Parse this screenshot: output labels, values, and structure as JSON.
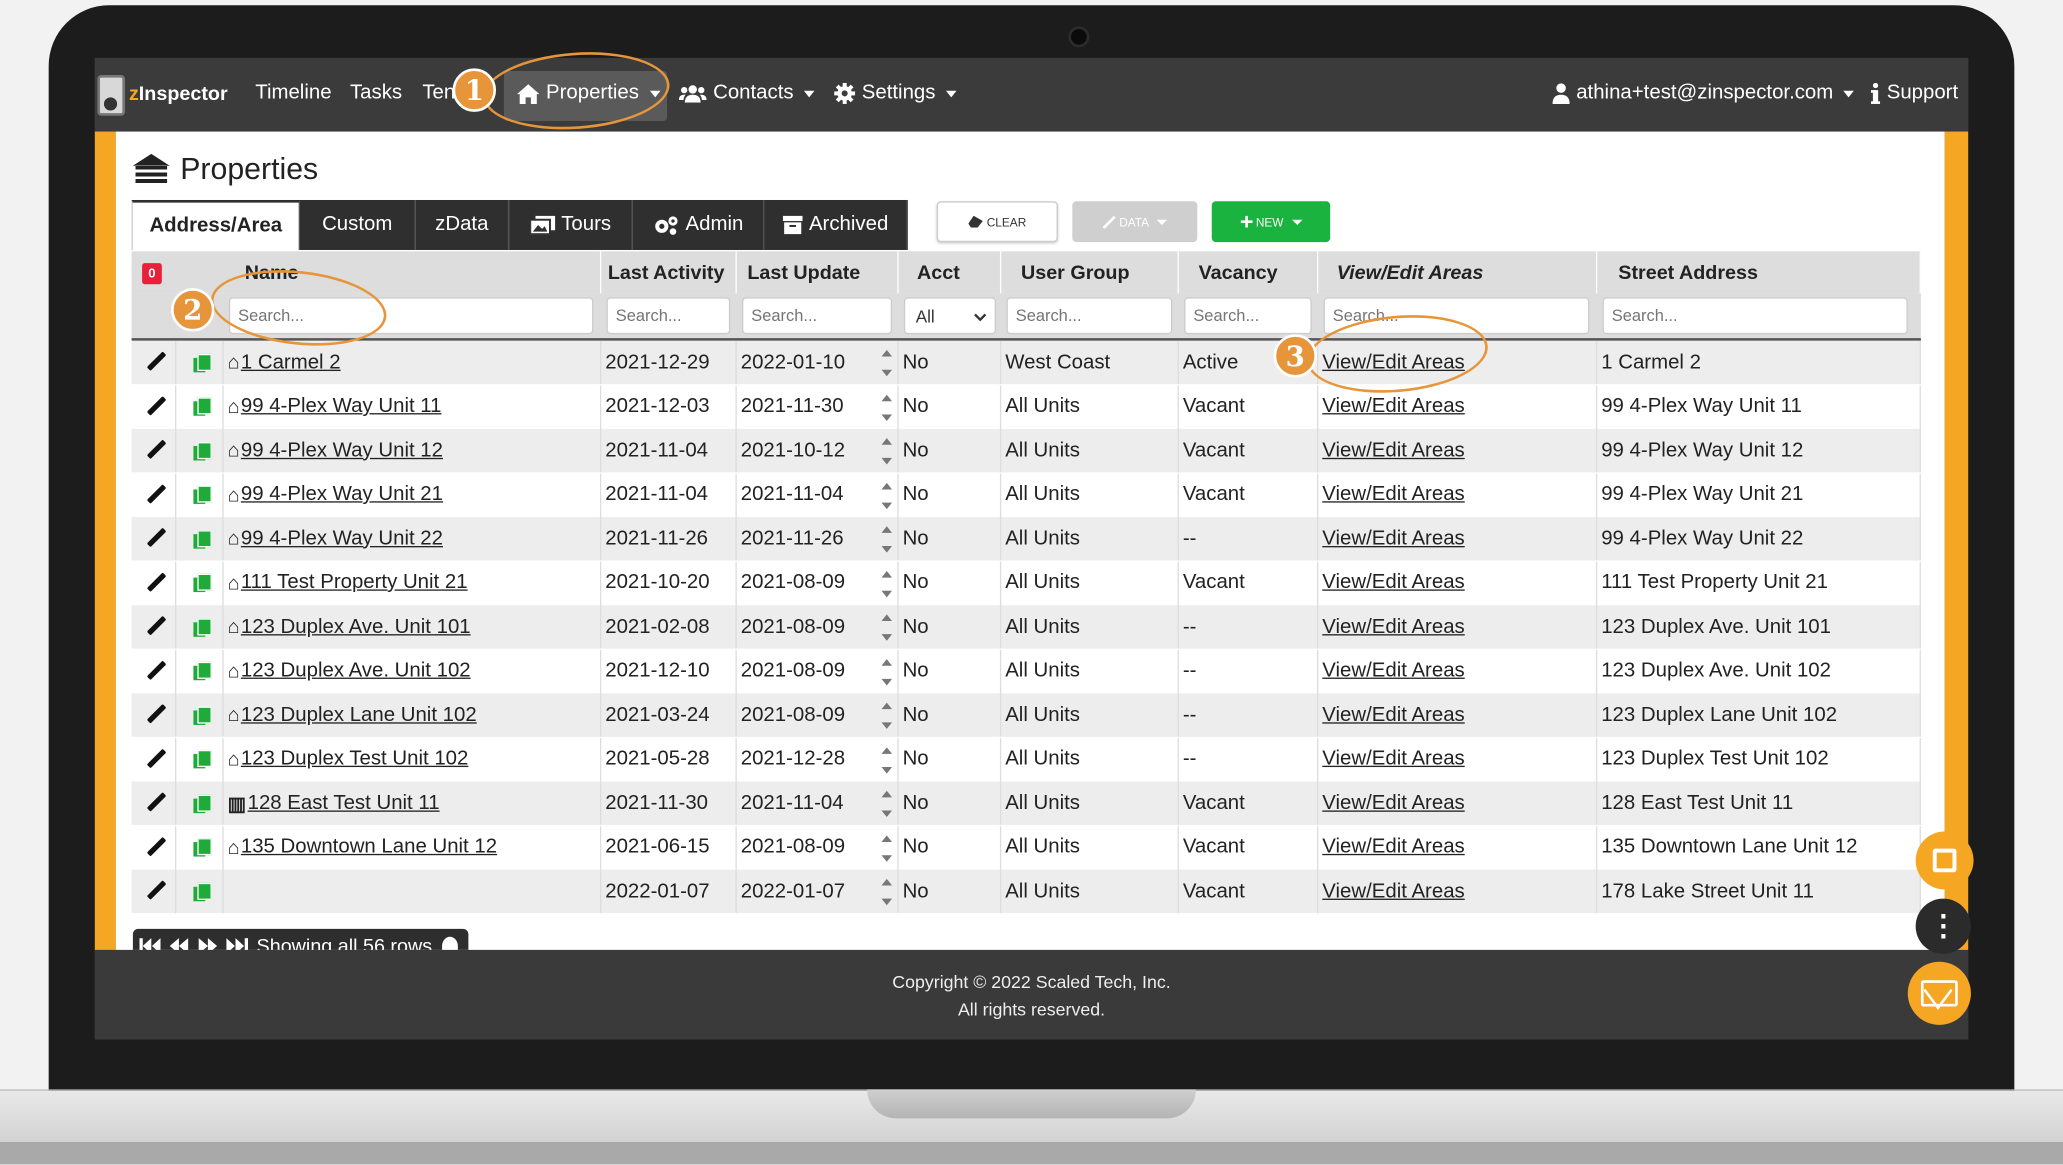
{
  "nav": {
    "brand": "zInspector",
    "brand_prefix": "z",
    "brand_suffix": "Inspector",
    "items": [
      "Timeline",
      "Tasks",
      "Templates"
    ],
    "items_visible": [
      "Timeline",
      "Tasks",
      "Ten"
    ],
    "properties": "Properties",
    "contacts": "Contacts",
    "settings": "Settings",
    "user": "athina+test@zinspector.com",
    "support": "Support"
  },
  "page": {
    "title": "Properties"
  },
  "tabs": [
    "Address/Area",
    "Custom",
    "zData",
    "Tours",
    "Admin",
    "Archived"
  ],
  "toolbar": {
    "clear": "CLEAR",
    "data": "DATA",
    "new": "NEW"
  },
  "table": {
    "badge": "0",
    "columns": [
      "Name",
      "Last Activity",
      "Last Update",
      "Acct",
      "User Group",
      "Vacancy",
      "View/Edit Areas",
      "Street Address"
    ],
    "search_placeholder": "Search...",
    "acct_filter": "All",
    "rows": [
      {
        "name": "1 Carmel 2",
        "icon": "home",
        "activity": "2021-12-29",
        "update": "2022-01-10",
        "acct": "No",
        "group": "West Coast",
        "vacancy": "Active",
        "areas": "View/Edit Areas",
        "address": "1 Carmel 2"
      },
      {
        "name": "99 4-Plex Way Unit 11",
        "icon": "home",
        "activity": "2021-12-03",
        "update": "2021-11-30",
        "acct": "No",
        "group": "All Units",
        "vacancy": "Vacant",
        "areas": "View/Edit Areas",
        "address": "99 4-Plex Way Unit 11"
      },
      {
        "name": "99 4-Plex Way Unit 12",
        "icon": "home",
        "activity": "2021-11-04",
        "update": "2021-10-12",
        "acct": "No",
        "group": "All Units",
        "vacancy": "Vacant",
        "areas": "View/Edit Areas",
        "address": "99 4-Plex Way Unit 12"
      },
      {
        "name": "99 4-Plex Way Unit 21",
        "icon": "home",
        "activity": "2021-11-04",
        "update": "2021-11-04",
        "acct": "No",
        "group": "All Units",
        "vacancy": "Vacant",
        "areas": "View/Edit Areas",
        "address": "99 4-Plex Way Unit 21"
      },
      {
        "name": "99 4-Plex Way Unit 22",
        "icon": "home",
        "activity": "2021-11-26",
        "update": "2021-11-26",
        "acct": "No",
        "group": "All Units",
        "vacancy": "--",
        "areas": "View/Edit Areas",
        "address": "99 4-Plex Way Unit 22"
      },
      {
        "name": "111 Test Property Unit 21",
        "icon": "home",
        "activity": "2021-10-20",
        "update": "2021-08-09",
        "acct": "No",
        "group": "All Units",
        "vacancy": "Vacant",
        "areas": "View/Edit Areas",
        "address": "111 Test Property Unit 21"
      },
      {
        "name": "123 Duplex Ave. Unit 101",
        "icon": "home",
        "activity": "2021-02-08",
        "update": "2021-08-09",
        "acct": "No",
        "group": "All Units",
        "vacancy": "--",
        "areas": "View/Edit Areas",
        "address": "123 Duplex Ave. Unit 101"
      },
      {
        "name": "123 Duplex Ave. Unit 102",
        "icon": "home",
        "activity": "2021-12-10",
        "update": "2021-08-09",
        "acct": "No",
        "group": "All Units",
        "vacancy": "--",
        "areas": "View/Edit Areas",
        "address": "123 Duplex Ave. Unit 102"
      },
      {
        "name": "123 Duplex Lane Unit 102",
        "icon": "home",
        "activity": "2021-03-24",
        "update": "2021-08-09",
        "acct": "No",
        "group": "All Units",
        "vacancy": "--",
        "areas": "View/Edit Areas",
        "address": "123 Duplex Lane Unit 102"
      },
      {
        "name": "123 Duplex Test Unit 102",
        "icon": "home",
        "activity": "2021-05-28",
        "update": "2021-12-28",
        "acct": "No",
        "group": "All Units",
        "vacancy": "--",
        "areas": "View/Edit Areas",
        "address": "123 Duplex Test Unit 102"
      },
      {
        "name": "128 East Test Unit 11",
        "icon": "building",
        "activity": "2021-11-30",
        "update": "2021-11-04",
        "acct": "No",
        "group": "All Units",
        "vacancy": "Vacant",
        "areas": "View/Edit Areas",
        "address": "128 East Test Unit 11"
      },
      {
        "name": "135 Downtown Lane Unit 12",
        "icon": "home",
        "activity": "2021-06-15",
        "update": "2021-08-09",
        "acct": "No",
        "group": "All Units",
        "vacancy": "Vacant",
        "areas": "View/Edit Areas",
        "address": "135 Downtown Lane Unit 12"
      },
      {
        "name": "",
        "icon": "",
        "activity": "2022-01-07",
        "update": "2022-01-07",
        "acct": "No",
        "group": "All Units",
        "vacancy": "Vacant",
        "areas": "View/Edit Areas",
        "address": "178 Lake Street Unit 11"
      }
    ]
  },
  "pager": {
    "status": "Showing all 56 rows"
  },
  "footer": {
    "line1": "Copyright © 2022 Scaled Tech, Inc.",
    "line2": "All rights reserved."
  },
  "annotations": [
    "1",
    "2",
    "3"
  ],
  "colors": {
    "accent": "#f5a623",
    "new_button": "#1ab33f",
    "annotation": "#e6953a",
    "navbar": "#3b3b3b"
  }
}
